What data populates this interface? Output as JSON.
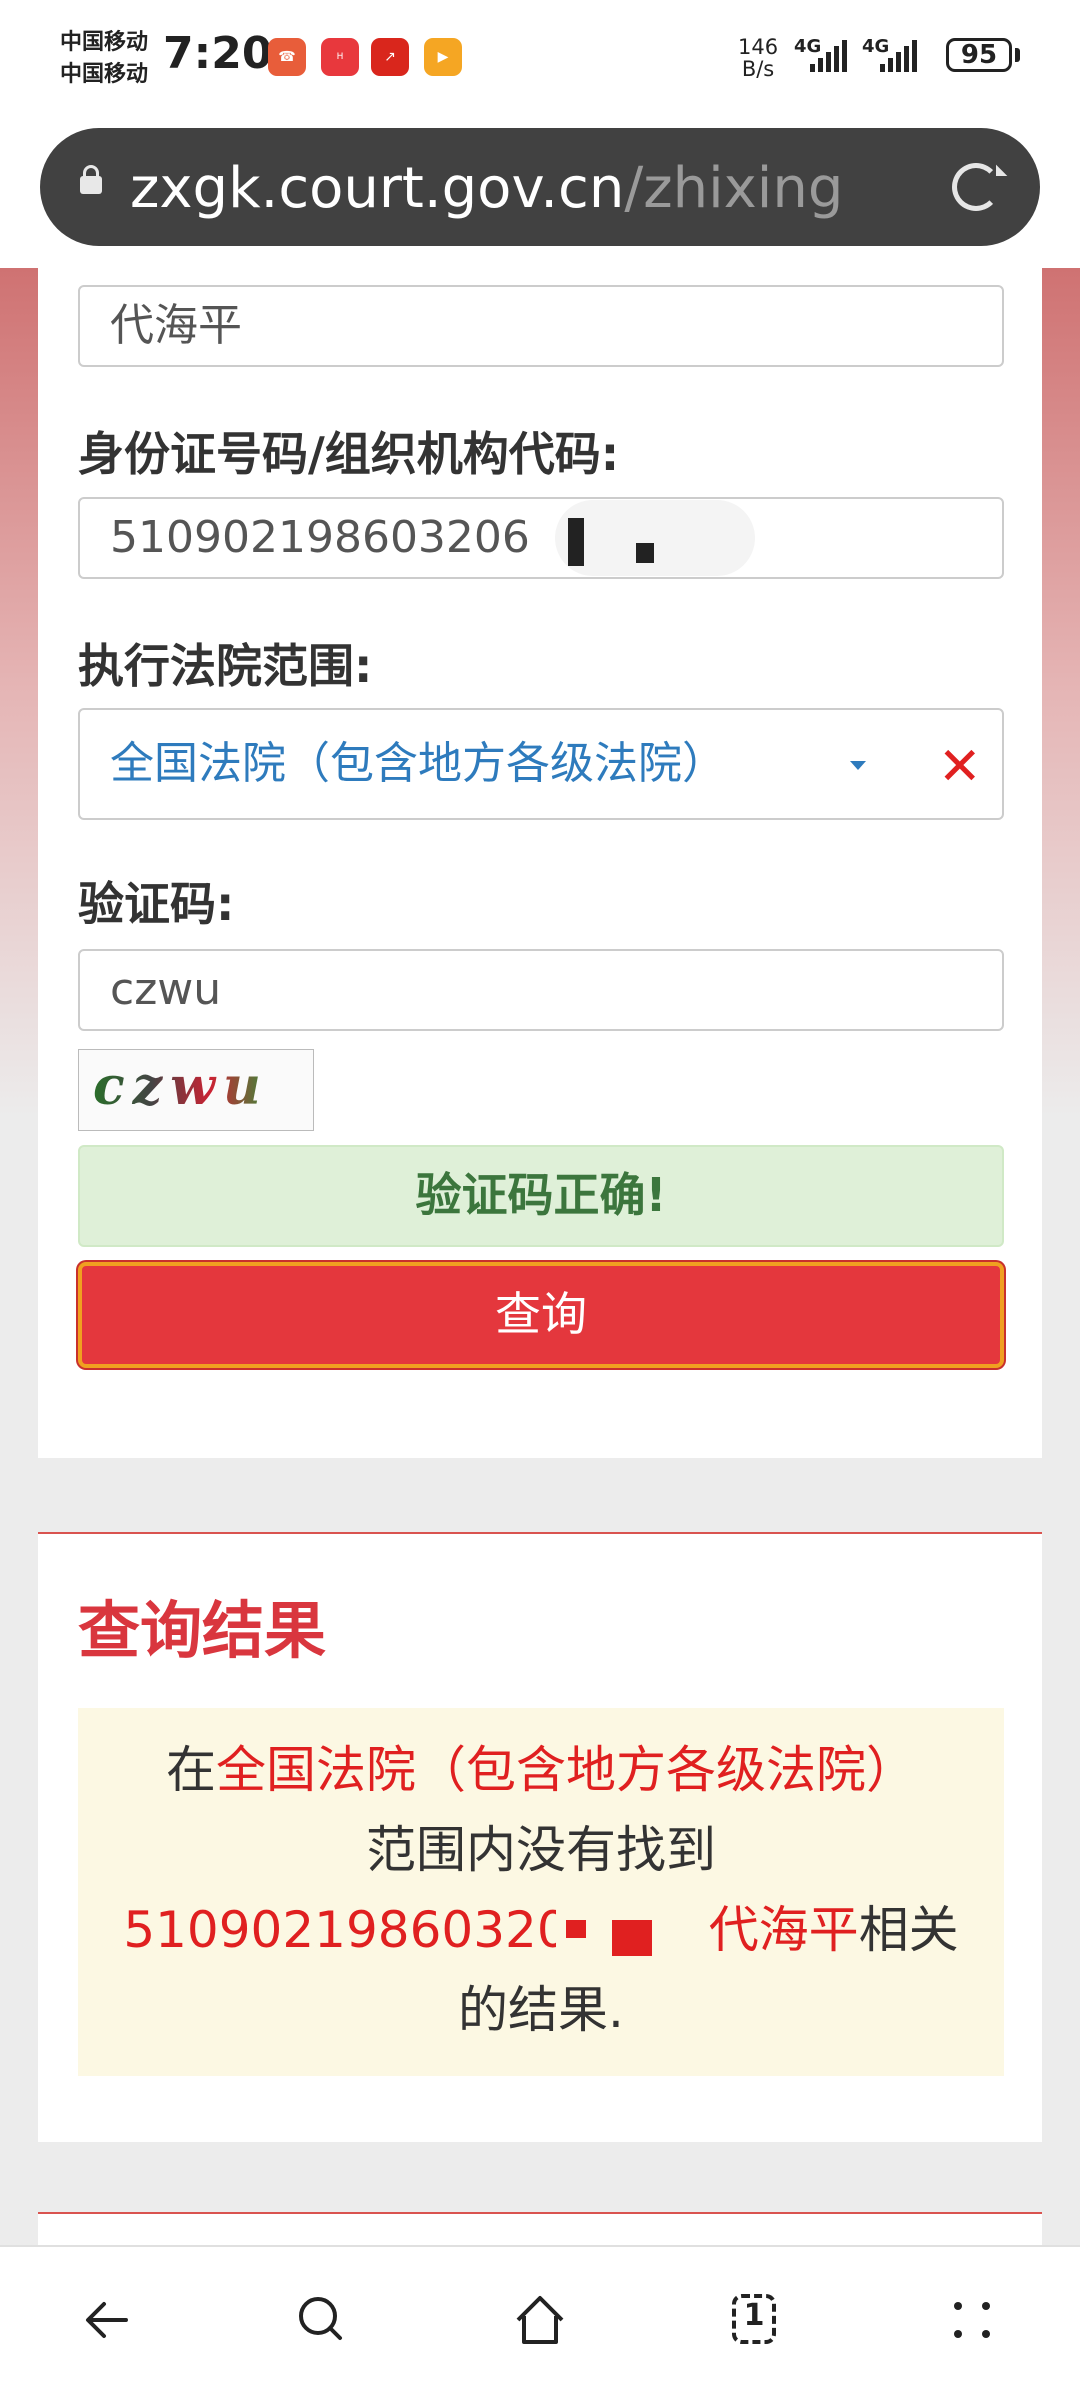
{
  "status_bar": {
    "carrier_1": "中国移动",
    "carrier_2": "中国移动",
    "time": "7:20",
    "net_speed_value": "146",
    "net_speed_unit": "B/s",
    "signal_1_label": "4G",
    "signal_2_label": "4G",
    "battery": "95"
  },
  "browser": {
    "url_domain": "zxgk.court.gov.cn",
    "url_path": "/zhixing"
  },
  "form": {
    "name_value": "代海平",
    "id_label": "身份证号码/组织机构代码:",
    "id_value": "510902198603206",
    "court_label": "执行法院范围:",
    "court_value": "全国法院（包含地方各级法院）",
    "captcha_label": "验证码:",
    "captcha_value": "czwu",
    "captcha_image_text": "czwu",
    "captcha_ok": "验证码正确!",
    "query_button": "查询"
  },
  "result": {
    "title": "查询结果",
    "prefix": "在",
    "scope": "全国法院（包含地方各级法院）",
    "mid": "范围内没有找到",
    "id_partial": "51090219860320",
    "name": "代海平",
    "suffix": "相关",
    "end": "的结果."
  },
  "nav": {
    "icons": [
      "back-icon",
      "search-icon",
      "home-icon",
      "tabs-icon",
      "menu-icon"
    ],
    "tabs_count": "1"
  },
  "colors": {
    "accent_red": "#e4373d",
    "link_blue": "#2e7bbd",
    "success_bg": "#dff0d8",
    "warning_bg": "#fcf8e3"
  }
}
